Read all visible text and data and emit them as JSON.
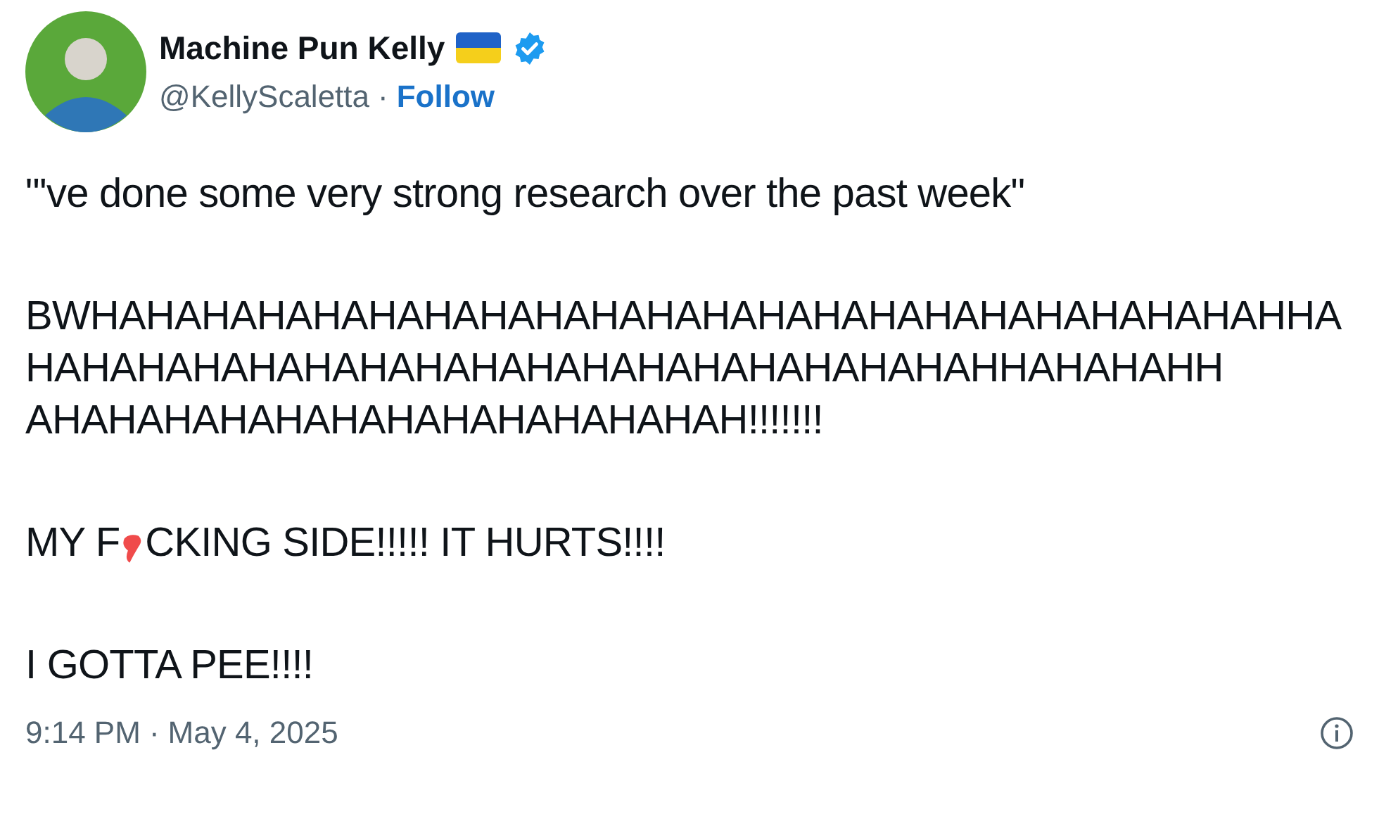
{
  "author": {
    "name": "Machine Pun Kelly",
    "handle": "@KellyScaletta",
    "separator": "·",
    "follow": "Follow",
    "verified": true
  },
  "paragraphs": [
    {
      "kind": "text",
      "lines": [
        "\"'ve done some very strong research over the past week\""
      ]
    },
    {
      "kind": "text",
      "lines": [
        "BWHAHAHAHAHAHAHAHAHAHAHAHAHAHAHAHAHAHAHAHAHAHHA",
        "HAHAHAHAHAHAHAHAHAHAHAHAHAHAHAHAHAHHAHAHAHH",
        "AHAHAHAHAHAHAHAHAHAHAHAHAH!!!!!!!"
      ]
    },
    {
      "kind": "redacted",
      "before": "MY F",
      "after": "CKING SIDE!!!!! IT HURTS!!!!"
    },
    {
      "kind": "text",
      "lines": [
        "I GOTTA PEE!!!!"
      ]
    }
  ],
  "footer": {
    "time": "9:14 PM",
    "separator": "·",
    "date": "May 4, 2025"
  }
}
